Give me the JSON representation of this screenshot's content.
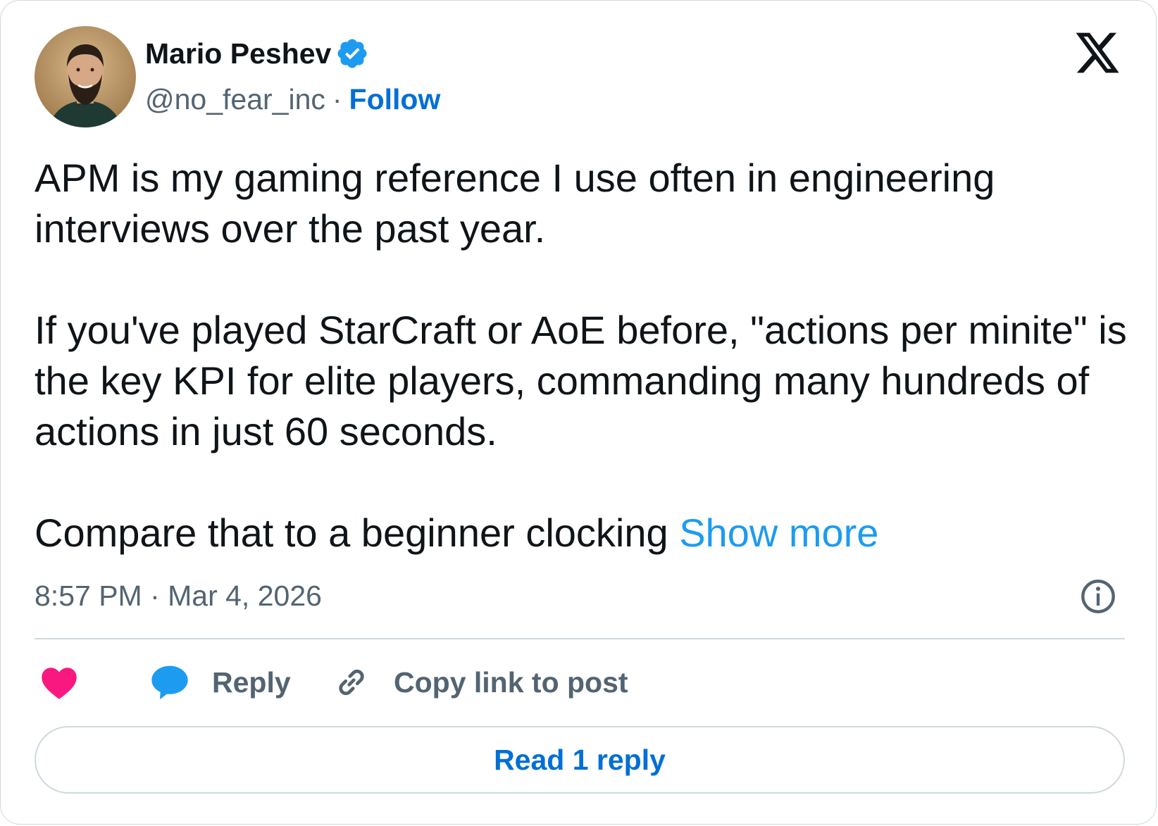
{
  "author": {
    "name": "Mario Peshev",
    "handle": "@no_fear_inc",
    "separator": "·",
    "follow_label": "Follow",
    "verified": true,
    "avatar_icon": "avatar-photo",
    "verified_icon": "verified-badge-icon"
  },
  "brand": {
    "logo_icon": "x-logo-icon"
  },
  "tweet": {
    "paragraphs": [
      "APM is my gaming reference I use often in engineering interviews over the past year.",
      "If you've played StarCraft or AoE before, \"actions per minite\" is the key KPI for elite players, commanding many hundreds of actions in just 60 seconds.",
      "Compare that to a beginner clocking"
    ],
    "show_more_label": "Show more",
    "timestamp": "8:57 PM · Mar 4, 2026"
  },
  "actions": {
    "like_icon": "heart-icon",
    "reply_icon": "speech-bubble-icon",
    "reply_label": "Reply",
    "copy_icon": "link-icon",
    "copy_label": "Copy link to post",
    "info_icon": "info-icon"
  },
  "replies": {
    "read_label": "Read 1 reply"
  },
  "colors": {
    "accent": "#006fd6",
    "show_more": "#1d9bf0",
    "like": "#f91880",
    "reply": "#1d9bf0",
    "muted": "#536471",
    "border": "#cfd9de",
    "text": "#0f1419"
  }
}
